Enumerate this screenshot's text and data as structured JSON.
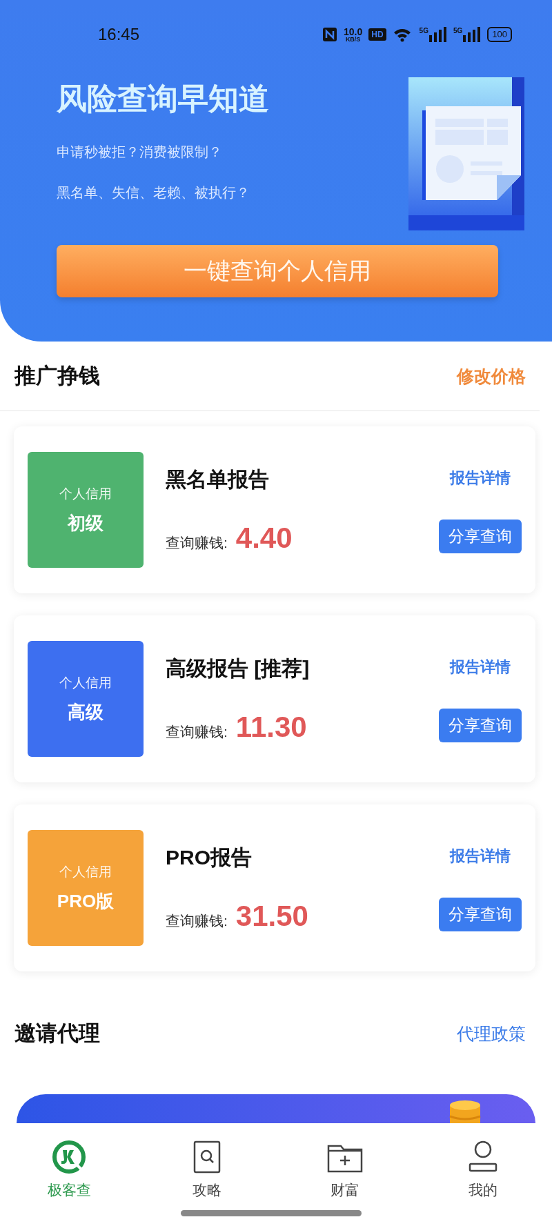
{
  "status_bar": {
    "time": "16:45",
    "speed_value": "10.0",
    "speed_unit": "KB/S",
    "hd": "HD",
    "networks": [
      "5G",
      "5G"
    ],
    "battery": "100"
  },
  "hero": {
    "title": "风险查询早知道",
    "lines": [
      "申请秒被拒？消费被限制？",
      "黑名单、失信、老赖、被执行？"
    ],
    "button": "一键查询个人信用"
  },
  "promo_section": {
    "title": "推广挣钱",
    "action": "修改价格"
  },
  "reports": [
    {
      "badge_top": "个人信用",
      "badge_main": "初级",
      "color": "#4fb36f",
      "name": "黑名单报告",
      "detail": "报告详情",
      "earn_label": "查询赚钱:",
      "price": "4.40",
      "share": "分享查询"
    },
    {
      "badge_top": "个人信用",
      "badge_main": "高级",
      "color": "#3d6ff0",
      "name": "高级报告 [推荐]",
      "detail": "报告详情",
      "earn_label": "查询赚钱:",
      "price": "11.30",
      "share": "分享查询"
    },
    {
      "badge_top": "个人信用",
      "badge_main": "PRO版",
      "color": "#f5a33a",
      "name": "PRO报告",
      "detail": "报告详情",
      "earn_label": "查询赚钱:",
      "price": "31.50",
      "share": "分享查询"
    }
  ],
  "invite_section": {
    "title": "邀请代理",
    "action": "代理政策"
  },
  "nav": [
    {
      "kind": "logo",
      "label": "极客查",
      "selected": true
    },
    {
      "kind": "search",
      "label": "攻略",
      "selected": false
    },
    {
      "kind": "folder",
      "label": "财富",
      "selected": false
    },
    {
      "kind": "user",
      "label": "我的",
      "selected": false
    }
  ]
}
